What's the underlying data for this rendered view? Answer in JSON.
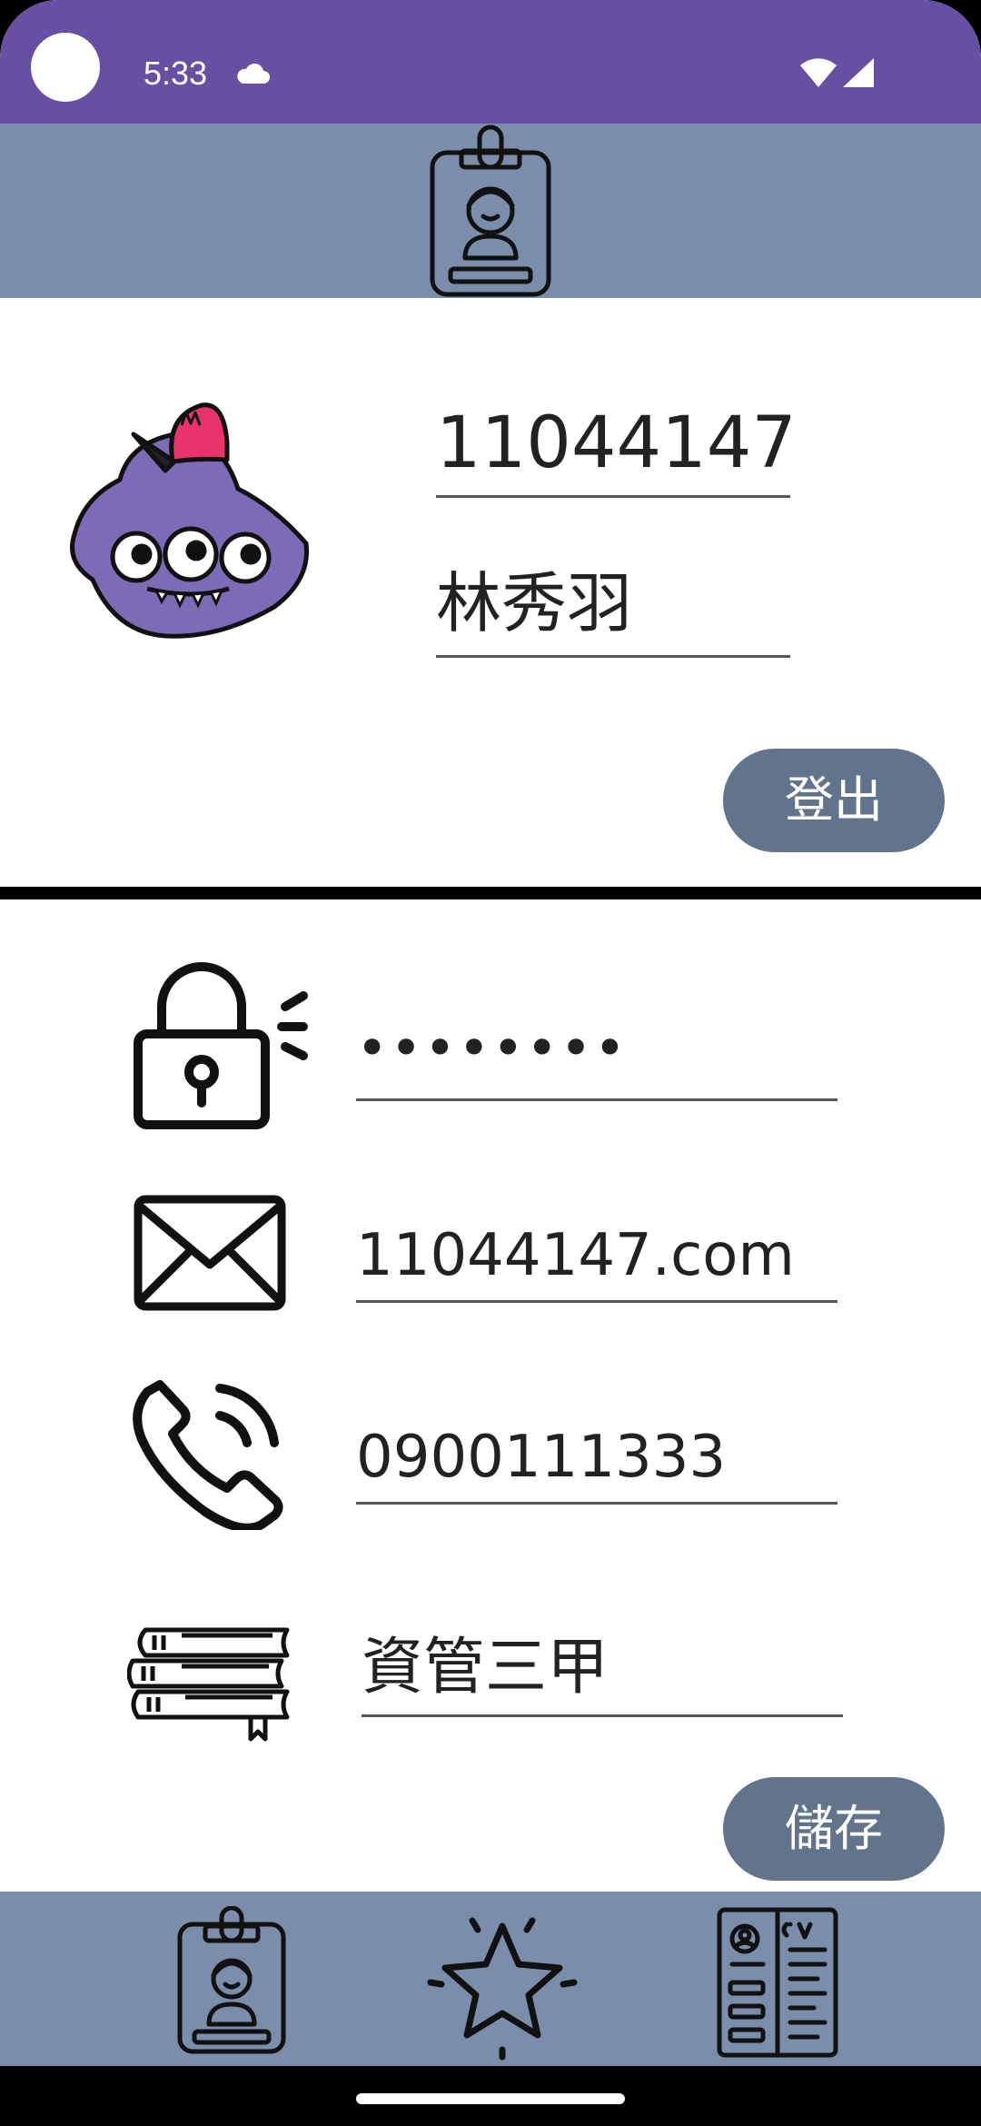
{
  "status_bar": {
    "time": "5:33",
    "icons": [
      "cloud-icon",
      "wifi-icon",
      "signal-icon"
    ],
    "background": "#6750a4"
  },
  "app_bar": {
    "icon": "id-badge-icon",
    "background": "#7a8daa"
  },
  "profile": {
    "avatar_icon": "purple-monster-avatar",
    "student_id": "11044147",
    "name": "林秀羽",
    "logout_label": "登出"
  },
  "details": {
    "password": "••••••••",
    "email": "11044147.com",
    "phone": "0900111333",
    "class_name": "資管三甲",
    "save_label": "儲存"
  },
  "bottom_nav": {
    "items": [
      "id-badge-icon",
      "star-icon",
      "cv-icon"
    ]
  },
  "colors": {
    "accent": "#6750a4",
    "bar": "#7a8daa",
    "button": "#62738c",
    "avatar": "#7d6bb8",
    "cap": "#e8336b"
  }
}
